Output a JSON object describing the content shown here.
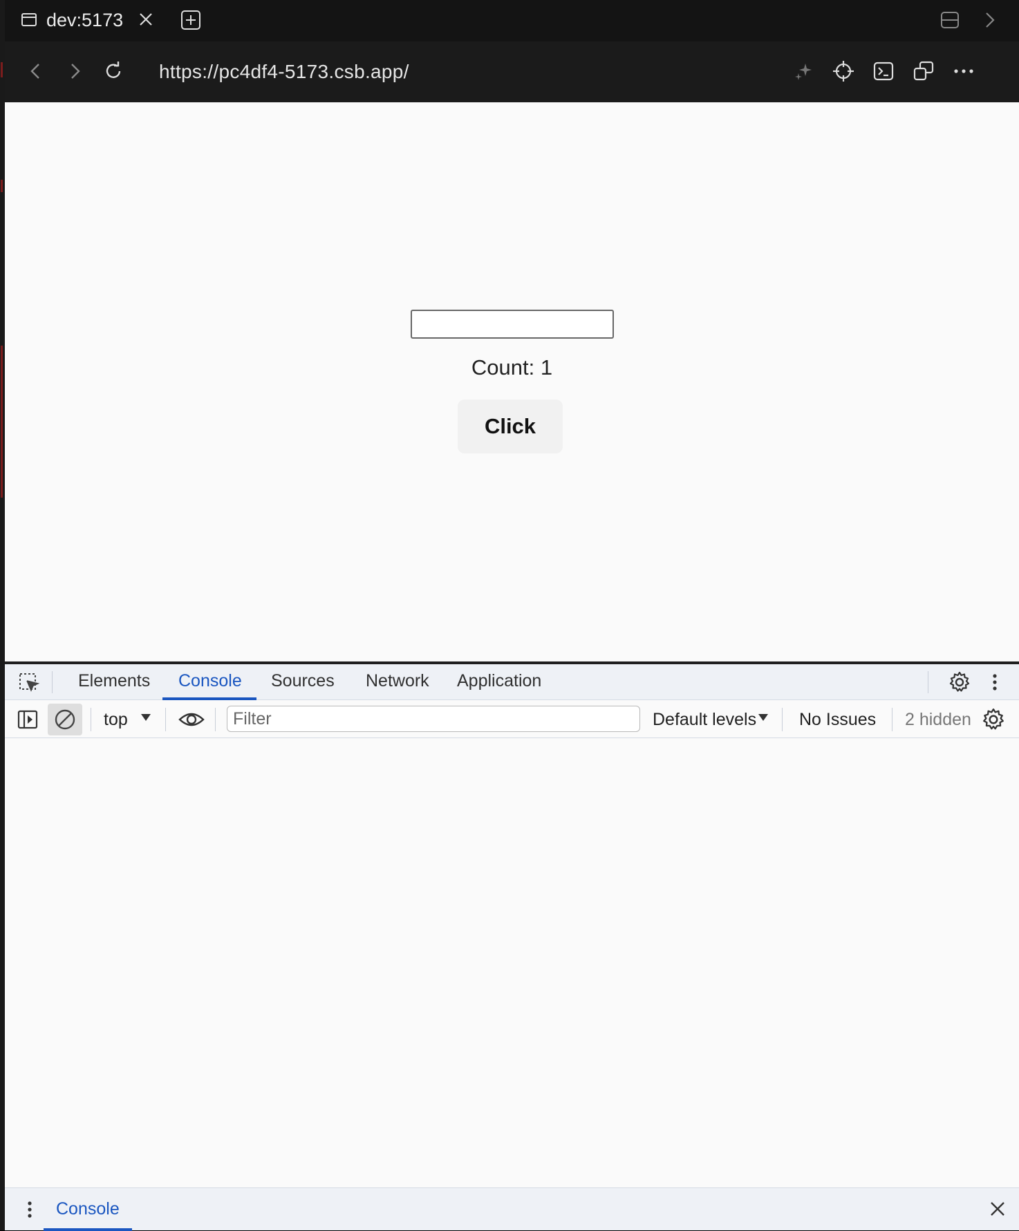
{
  "browser": {
    "tab_title": "dev:5173",
    "url": "https://pc4df4-5173.csb.app/"
  },
  "page": {
    "input_value": "",
    "count_text": "Count: 1",
    "button_label": "Click"
  },
  "devtools": {
    "tabs": [
      "Elements",
      "Console",
      "Sources",
      "Network",
      "Application"
    ],
    "active_tab": "Console",
    "context": "top",
    "filter_placeholder": "Filter",
    "levels": "Default levels",
    "issues": "No Issues",
    "hidden": "2 hidden",
    "drawer_tab": "Console"
  },
  "colors": {
    "accent": "#1a56c0"
  }
}
